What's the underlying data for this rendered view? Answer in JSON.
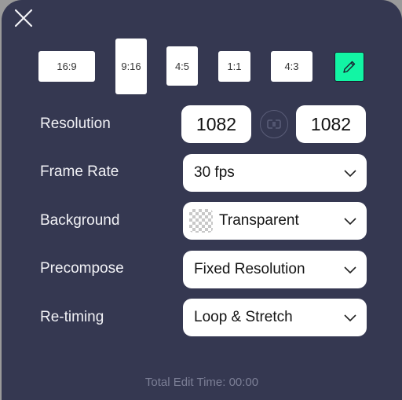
{
  "dialog": {
    "close_icon": "close-icon"
  },
  "aspect_ratios": [
    {
      "label": "16:9",
      "selected": false
    },
    {
      "label": "9:16",
      "selected": true
    },
    {
      "label": "4:5",
      "selected": false
    },
    {
      "label": "1:1",
      "selected": false
    },
    {
      "label": "4:3",
      "selected": false
    }
  ],
  "custom_ratio": {
    "icon": "pencil-icon",
    "color": "#12f5a4"
  },
  "settings": {
    "resolution": {
      "label": "Resolution",
      "width": "1082",
      "height": "1082",
      "link_icon": "link-icon"
    },
    "frame_rate": {
      "label": "Frame Rate",
      "value": "30 fps"
    },
    "background": {
      "label": "Background",
      "value": "Transparent",
      "swatch": "checkerboard"
    },
    "precompose": {
      "label": "Precompose",
      "value": "Fixed Resolution"
    },
    "retiming": {
      "label": "Re-timing",
      "value": "Loop & Stretch"
    }
  },
  "footer": {
    "total_edit_time": "Total Edit Time: 00:00"
  },
  "colors": {
    "panel_bg": "#353851",
    "accent": "#12f5a4"
  }
}
